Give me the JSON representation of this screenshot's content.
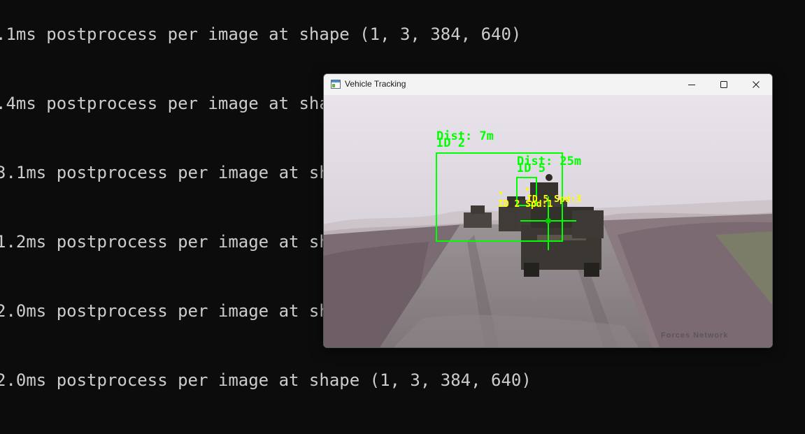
{
  "terminal": {
    "lines": [
      ".1ms postprocess per image at shape (1, 3, 384, 640)",
      ".4ms postprocess per image at shape (1, 3, 384, 640)",
      "3.1ms postprocess per image at shape (1, 3, 384, 640)",
      "1.2ms postprocess per image at shape (1, 3, 384, 640)",
      "2.0ms postprocess per image at shape (1, 3, 384, 640)",
      "2.0ms postprocess per image at shape (1, 3, 384, 640)"
    ],
    "text_color": "#cccccc",
    "background": "#0c0c0c"
  },
  "window": {
    "title": "Vehicle Tracking",
    "controls": {
      "minimize": "minimize-icon",
      "maximize": "maximize-icon",
      "close": "close-icon"
    }
  },
  "tracking": {
    "box_color": "#00ff00",
    "speed_color": "#ffff00",
    "detections": [
      {
        "dist_label": "Dist: 7m",
        "id_label": "ID 2",
        "speed_label": "ID 2 Spd:1"
      },
      {
        "dist_label": "Dist: 25m",
        "id_label": "ID 5",
        "speed_label": "ID 5 Spd:3"
      }
    ],
    "watermark": "Forces Network"
  }
}
